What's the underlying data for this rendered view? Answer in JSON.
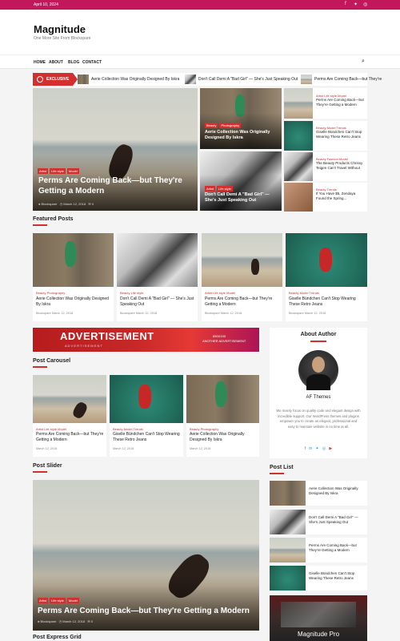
{
  "topbar": {
    "date": "April 10, 2024"
  },
  "site": {
    "name": "Magnitude",
    "tagline": "One More Site From Blockspare"
  },
  "nav": {
    "items": [
      "HOME",
      "ABOUT",
      "BLOG",
      "CONTACT"
    ]
  },
  "ticker": {
    "label": "EXCLUSIVE",
    "items": [
      "Aerie Collection Was Originally Designed By Iskra",
      "Don't Call Demi A \"Bad Girl\" — She's Just Speaking Out",
      "Perms Are Coming Back—but They're"
    ]
  },
  "hero": {
    "main": {
      "tags": [
        "Artist",
        "Life style",
        "Model"
      ],
      "title": "Perms Are Coming Back—but They're Getting a Modern",
      "author": "Blockspare",
      "date": "March 12, 2018",
      "comments": "0"
    },
    "mid_top": {
      "tags": [
        "Beauty",
        "Photography"
      ],
      "title": "Aerie Collection Was Originally Designed By Iskra"
    },
    "mid_bottom": {
      "tags": [
        "Artist",
        "Life style"
      ],
      "title": "Don't Call Demi A \"Bad Girl\" — She's Just Speaking Out"
    },
    "side": [
      {
        "cat": "Artist  Life style  Model",
        "title": "Perms Are Coming Back—but They're Getting a Modern"
      },
      {
        "cat": "Beauty  Model  Trends",
        "title": "Giselle Bündchen Can't Stop Wearing These Retro Jeans"
      },
      {
        "cat": "Beauty  Fashion  Model",
        "title": "The Beauty Products Chrissy Teigen Can't Travel Without"
      },
      {
        "cat": "Beauty  Trends",
        "title": "If You Have $5, Zendaya Found the Spring..."
      }
    ]
  },
  "featured": {
    "heading": "Featured Posts",
    "posts": [
      {
        "cat": "Beauty  Photography",
        "title": "Aerie Collection Was Originally Designed By Iskra",
        "meta": "Blockspare   March 12, 2018"
      },
      {
        "cat": "Beauty  Life style",
        "title": "Don't Call Demi A \"Bad Girl\" — She's Just Speaking Out",
        "meta": "Blockspare   March 12, 2018"
      },
      {
        "cat": "Artist  Life style  Model",
        "title": "Perms Are Coming Back—but They're Getting a Modern",
        "meta": "Blockspare   March 12, 2018"
      },
      {
        "cat": "Beauty  Model  Trends",
        "title": "Giselle Bündchen Can't Stop Wearing These Retro Jeans",
        "meta": "Blockspare   March 12, 2018"
      }
    ]
  },
  "ad": {
    "title": "ADVERTISEMENT",
    "sub": "A D V E R T I S E M E N T",
    "size": "850X100",
    "note": "ANOTHER ADVERTISEMENT"
  },
  "carousel": {
    "heading": "Post Carousel",
    "posts": [
      {
        "cat": "Artist  Life style  Model",
        "title": "Perms Are Coming Back—but They're Getting a Modern",
        "meta": "March 12, 2018"
      },
      {
        "cat": "Beauty  Model  Trends",
        "title": "Giselle Bündchen Can't Stop Wearing These Retro Jeans",
        "meta": "March 12, 2018"
      },
      {
        "cat": "Beauty  Photography",
        "title": "Aerie Collection Was Originally Designed By Iskra",
        "meta": "March 12, 2018"
      }
    ]
  },
  "slider": {
    "heading": "Post Slider",
    "tags": [
      "Artist",
      "Life style",
      "Model"
    ],
    "title": "Perms Are Coming Back—but They're Getting a Modern",
    "author": "Blockspare",
    "date": "March 12, 2018",
    "comments": "0"
  },
  "express": {
    "heading": "Post Express Grid"
  },
  "about": {
    "heading": "About Author",
    "name": "AF Themes",
    "bio": "We mainly focus on quality code and elegant design with incredible support. Our WordPress themes and plugins empower you to create an elegant, professional and easy to maintain website in no time at all."
  },
  "postlist": {
    "heading": "Post List",
    "items": [
      "Aerie Collection Was Originally Designed By Iskra",
      "Don't Call Demi A \"Bad Girl\" — She's Just Speaking Out",
      "Perms Are Coming Back—but They're Getting a Modern",
      "Giselle Bündchen Can't Stop Wearing These Retro Jeans"
    ]
  },
  "promo": {
    "title": "Magnitude Pro"
  },
  "colors": {
    "accent": "#d32f2f",
    "topbar": "#c2185b"
  }
}
